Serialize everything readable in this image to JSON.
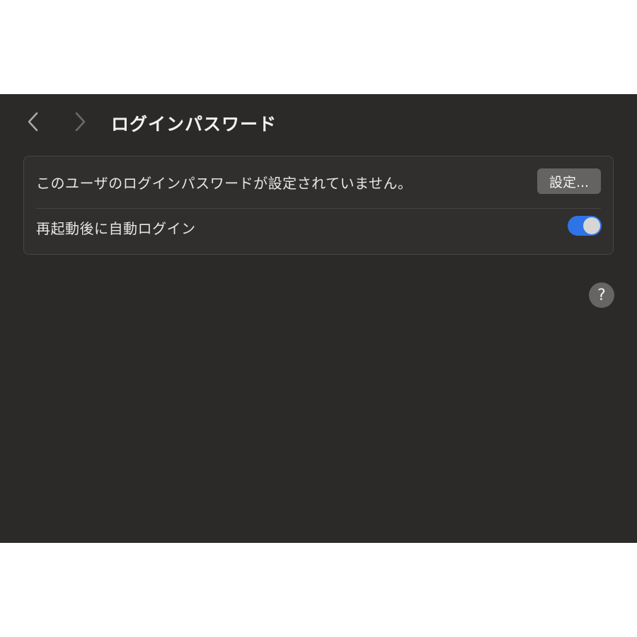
{
  "toolbar": {
    "back_icon": "chevron-left-icon",
    "forward_icon": "chevron-right-icon",
    "title": "ログインパスワード"
  },
  "settings": {
    "password_row": {
      "label": "このユーザのログインパスワードが設定されていません。",
      "button_label": "設定..."
    },
    "autologin_row": {
      "label": "再起動後に自動ログイン",
      "toggle_on": true
    }
  },
  "help": {
    "label": "?"
  },
  "colors": {
    "window_bg": "#2b2a29",
    "accent": "#2f74e6"
  }
}
